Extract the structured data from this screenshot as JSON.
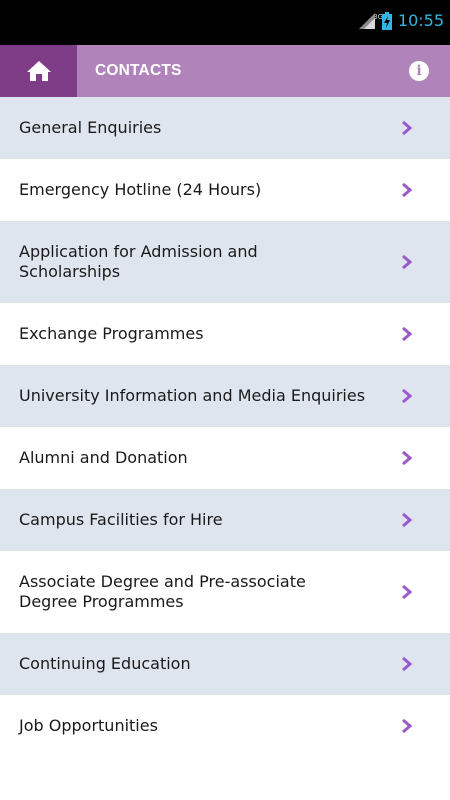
{
  "status_bar": {
    "network": "3G",
    "time": "10:55"
  },
  "app_bar": {
    "title": "CONTACTS",
    "home_icon": "home-icon",
    "info_icon": "info-icon"
  },
  "colors": {
    "app_bar": "#b084ba",
    "home_button": "#7e3d86",
    "row_odd": "#dfe5ef",
    "row_even": "#ffffff",
    "chevron": "#9b59d0",
    "clock": "#33b5e5"
  },
  "contacts": [
    {
      "label": "General Enquiries"
    },
    {
      "label": "Emergency Hotline (24 Hours)"
    },
    {
      "label": "Application for Admission and Scholarships"
    },
    {
      "label": "Exchange Programmes"
    },
    {
      "label": "University Information and Media Enquiries"
    },
    {
      "label": "Alumni and Donation"
    },
    {
      "label": "Campus Facilities for Hire"
    },
    {
      "label": "Associate Degree and Pre-associate Degree Programmes"
    },
    {
      "label": "Continuing Education"
    },
    {
      "label": "Job Opportunities"
    }
  ]
}
